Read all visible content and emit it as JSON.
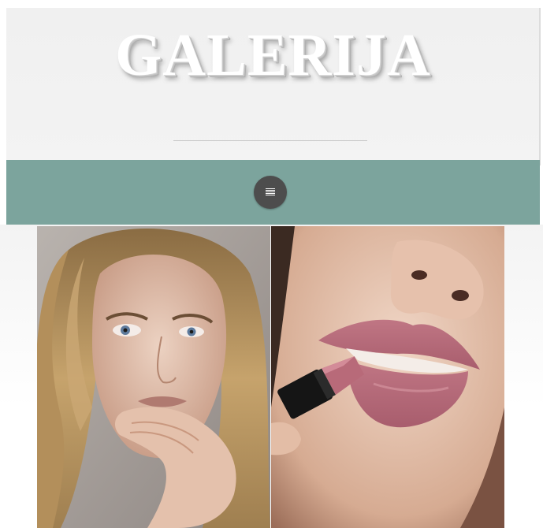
{
  "header": {
    "title": "GALERIJA"
  },
  "navbar": {
    "menu_icon": "hamburger-menu-icon",
    "background_color": "#7ca49d",
    "button_color": "#4d4d4d"
  },
  "gallery": {
    "photos": [
      {
        "subject": "blonde-woman-portrait"
      },
      {
        "subject": "lipstick-application-closeup"
      }
    ]
  }
}
